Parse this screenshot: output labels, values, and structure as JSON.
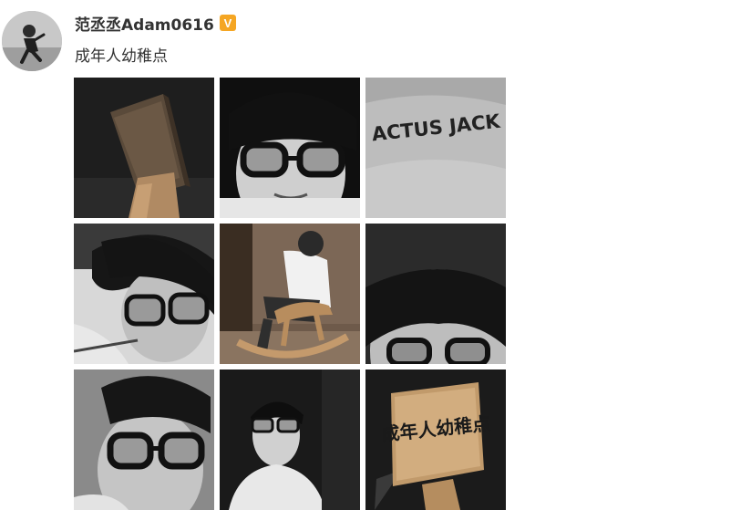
{
  "user": {
    "name": "范丞丞Adam0616",
    "verified_badge": "V",
    "avatar_icon": "user-avatar-icon"
  },
  "post": {
    "text": "成年人幼稚点"
  },
  "images": [
    {
      "name": "wooden-sign-photo",
      "shirt_text": ""
    },
    {
      "name": "portrait-glasses-photo",
      "shirt_text": ""
    },
    {
      "name": "grey-sweater-photo",
      "shirt_text": "ACTUS JACK"
    },
    {
      "name": "selfie-glasses-photo",
      "shirt_text": ""
    },
    {
      "name": "rocking-horse-photo",
      "shirt_text": ""
    },
    {
      "name": "close-up-face-photo",
      "shirt_text": ""
    },
    {
      "name": "selfie-glasses-2-photo",
      "shirt_text": ""
    },
    {
      "name": "mirror-selfie-photo",
      "shirt_text": ""
    },
    {
      "name": "wooden-fan-photo",
      "fan_text": "成年人幼稚点"
    }
  ],
  "colors": {
    "text": "#333333",
    "badge": "#f5a623"
  }
}
